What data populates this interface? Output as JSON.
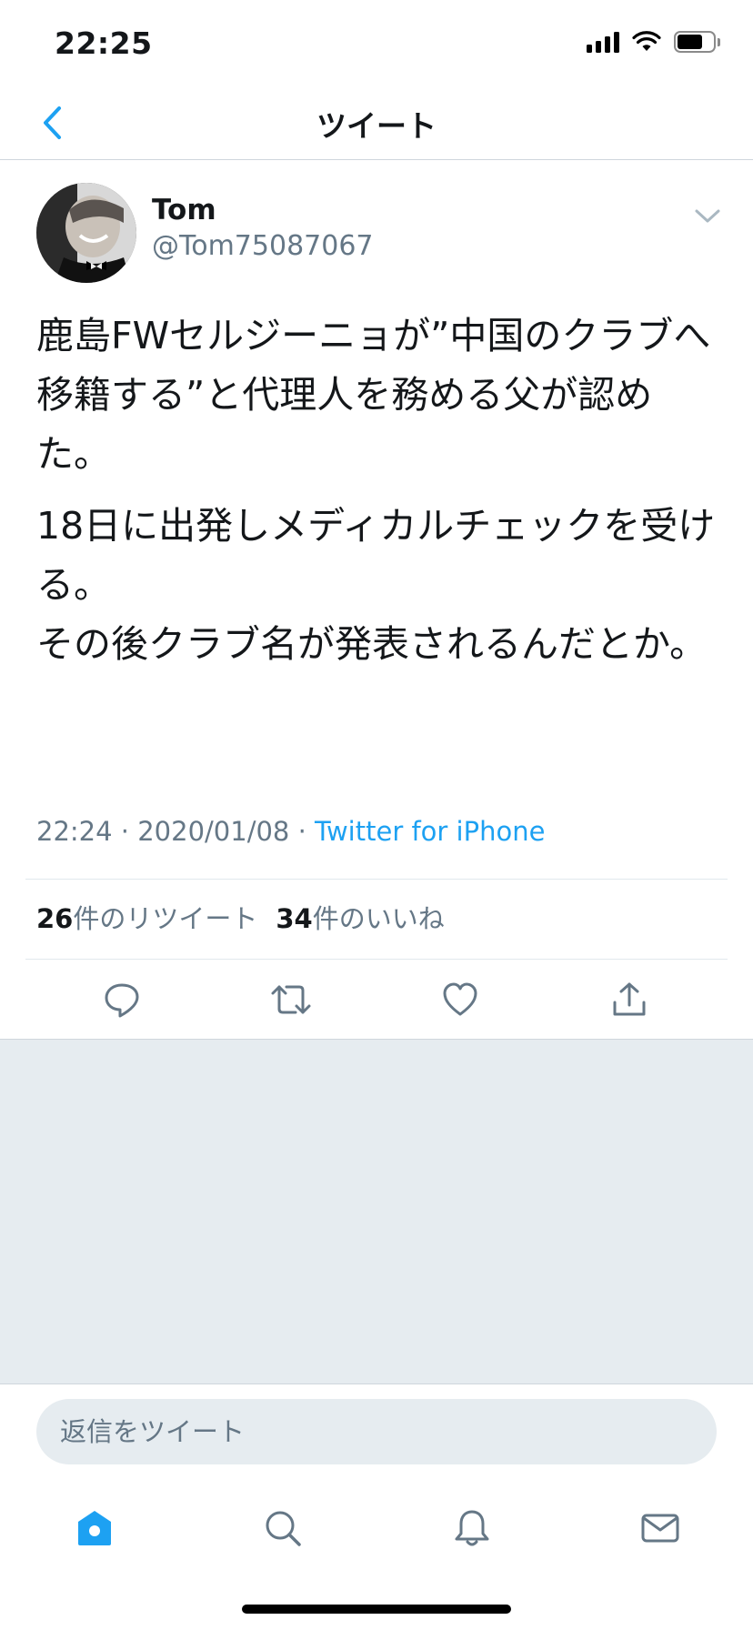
{
  "status_bar": {
    "time": "22:25",
    "signal_icon": "signal-icon",
    "wifi_icon": "wifi-icon",
    "battery_icon": "battery-icon"
  },
  "nav": {
    "title": "ツイート",
    "back_icon": "chevron-left-icon"
  },
  "tweet": {
    "user": {
      "name": "Tom",
      "handle": "@Tom75087067"
    },
    "paragraphs": [
      "鹿島FWセルジーニョが”中国のクラブへ移籍する”と代理人を務める父が認めた。",
      "18日に出発しメディカルチェックを受ける。",
      "その後クラブ名が発表されるんだとか。"
    ],
    "time": "22:24",
    "separator": "·",
    "date": "2020/01/08",
    "source": "Twitter for iPhone",
    "retweet_count": "26",
    "retweet_label": "件のリツイート",
    "like_count": "34",
    "like_label": "件のいいね"
  },
  "reply": {
    "placeholder": "返信をツイート"
  },
  "tabs": [
    {
      "name": "home",
      "icon": "home-icon",
      "active": true
    },
    {
      "name": "search",
      "icon": "search-icon",
      "active": false
    },
    {
      "name": "notifications",
      "icon": "bell-icon",
      "active": false
    },
    {
      "name": "messages",
      "icon": "mail-icon",
      "active": false
    }
  ],
  "colors": {
    "accent": "#1da1f2",
    "secondary_text": "#657786",
    "background_gray": "#e6ecf0"
  }
}
